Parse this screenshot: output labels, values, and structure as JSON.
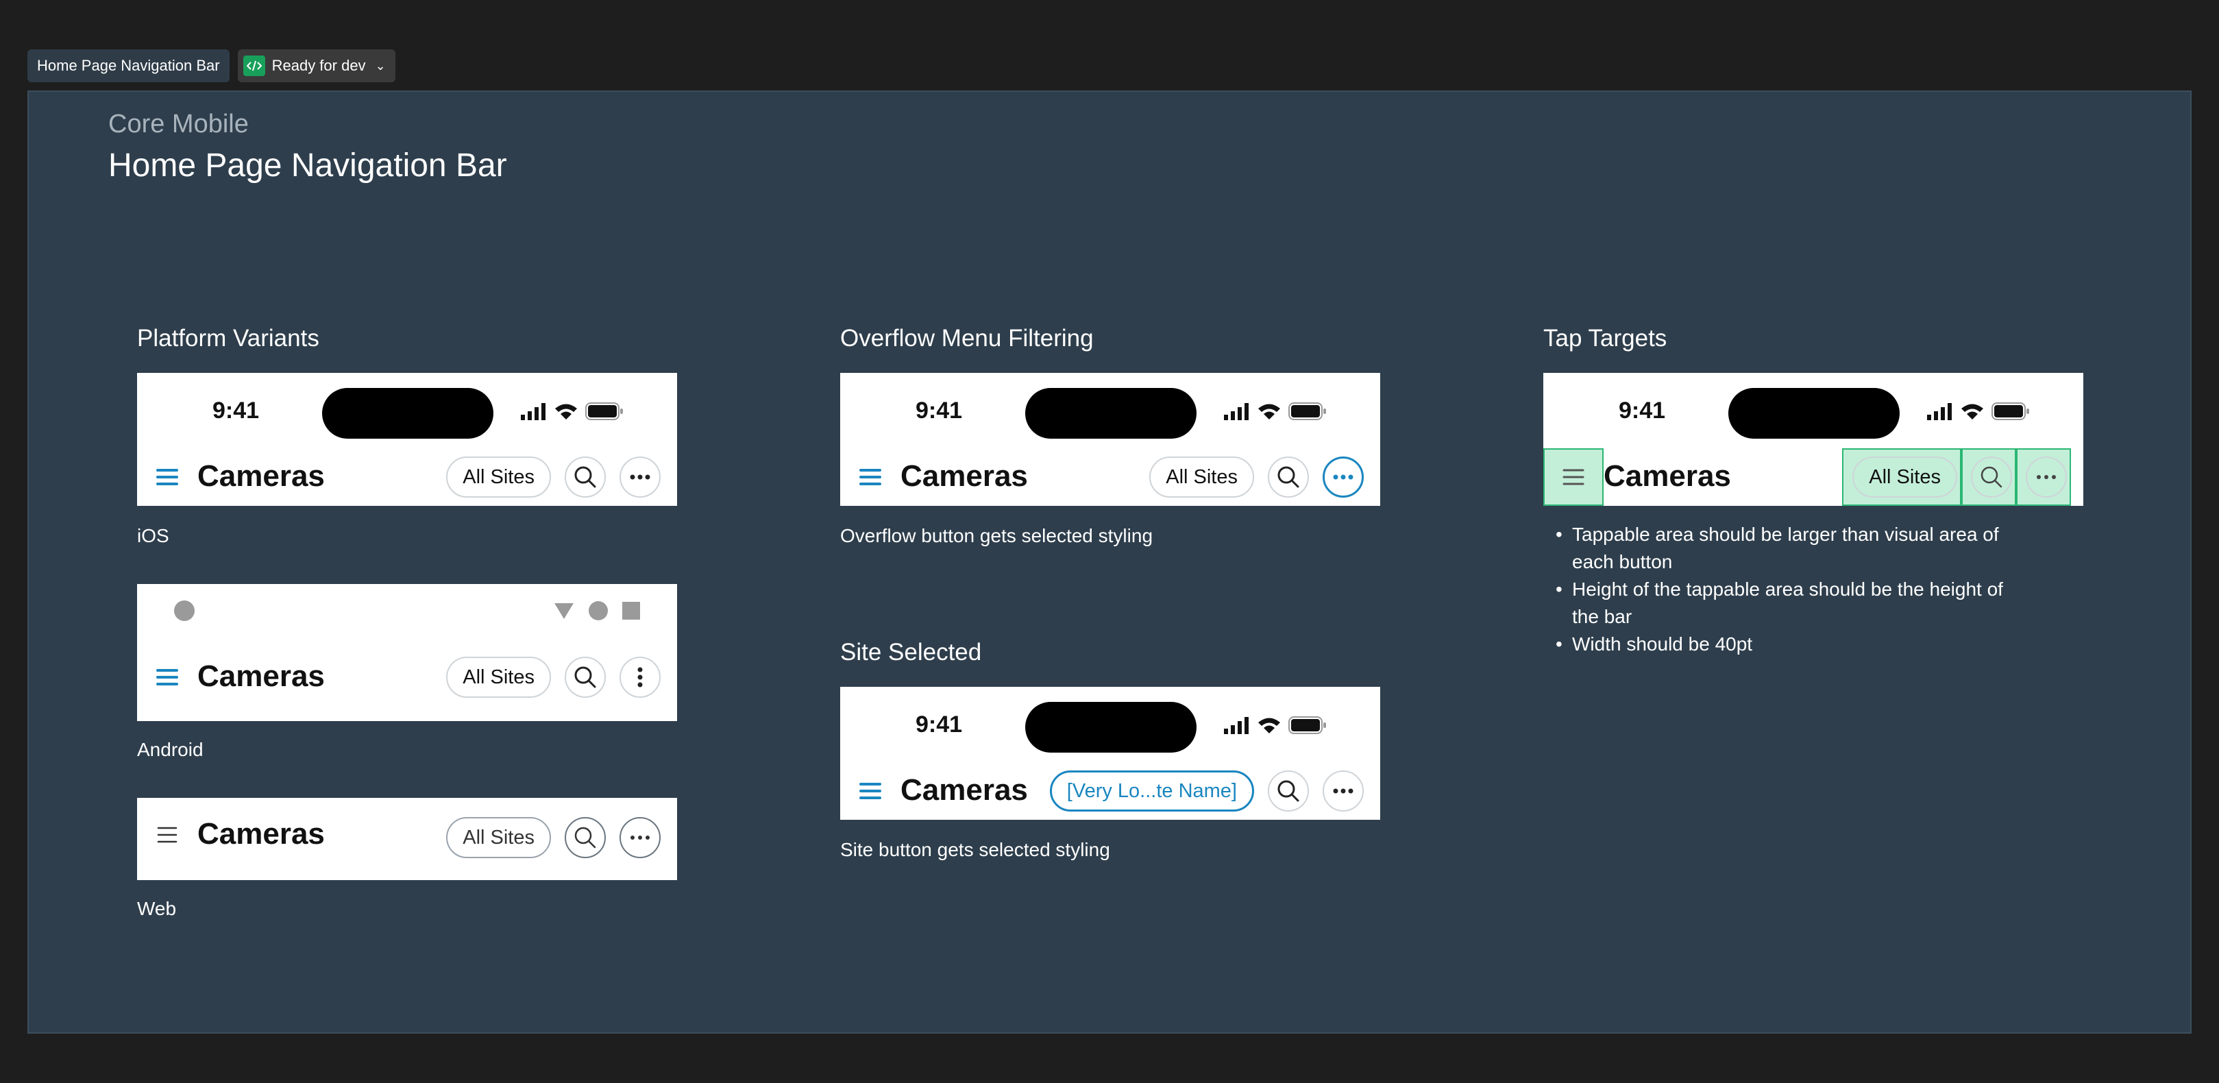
{
  "header": {
    "frame_label": "Home Page Navigation Bar",
    "status_label": "Ready for dev",
    "status_icon": "code-icon",
    "status_chevron": "⌄"
  },
  "page": {
    "eyebrow": "Core Mobile",
    "title": "Home Page Navigation Bar"
  },
  "sections": {
    "platform": "Platform Variants",
    "overflow": "Overflow Menu Filtering",
    "site_selected": "Site Selected",
    "tap_targets": "Tap Targets"
  },
  "captions": {
    "ios": "iOS",
    "android": "Android",
    "web": "Web",
    "overflow": "Overflow button gets selected styling",
    "site": "Site button gets selected styling"
  },
  "status_bar": {
    "time": "9:41"
  },
  "nav": {
    "title": "Cameras",
    "sites_label": "All Sites",
    "selected_site_label": "[Very Lo...te Name]"
  },
  "tap_notes": [
    "Tappable area should be larger than visual area of each button",
    "Height of the tappable area should be the height of the bar",
    "Width should be 40pt"
  ],
  "colors": {
    "canvas": "#2e3e4c",
    "accent": "#1a86c0",
    "tap_highlight": "#2bb673",
    "ready_badge": "#18a05a"
  }
}
